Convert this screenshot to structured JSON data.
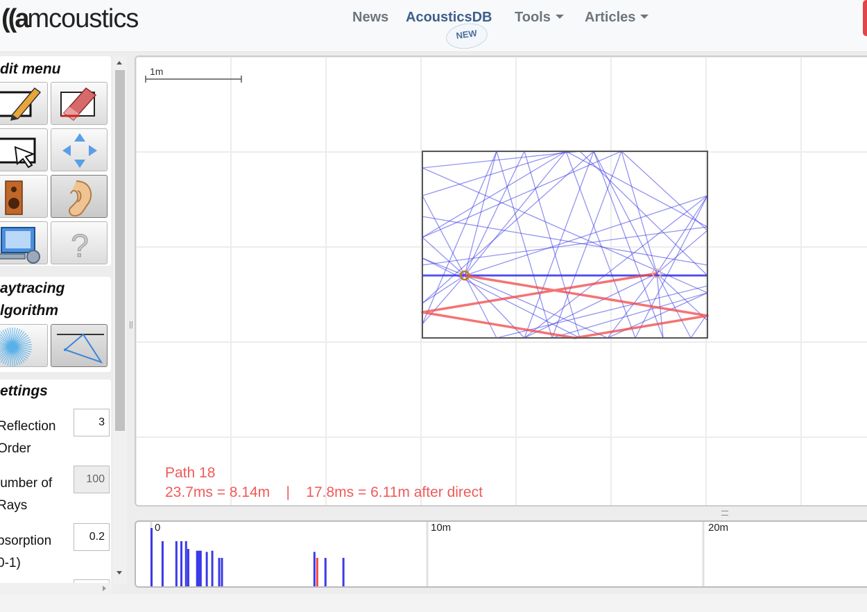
{
  "header": {
    "logo_mark": "((a",
    "logo_text": "mcoustics",
    "nav": [
      {
        "label": "News",
        "dropdown": false
      },
      {
        "label": "AcousticsDB",
        "dropdown": false
      },
      {
        "label": "Tools",
        "dropdown": true
      },
      {
        "label": "Articles",
        "dropdown": true
      }
    ],
    "new_badge": "NEW"
  },
  "sidebar": {
    "edit_menu_title": "dit menu",
    "tools": [
      {
        "icon": "pencil-draw-icon",
        "active": false
      },
      {
        "icon": "eraser-icon",
        "active": false
      },
      {
        "icon": "select-pointer-icon",
        "active": false
      },
      {
        "icon": "move-arrows-icon",
        "active": false
      },
      {
        "icon": "speaker-icon",
        "active": false
      },
      {
        "icon": "ear-icon",
        "active": true
      },
      {
        "icon": "monitor-settings-icon",
        "active": false
      },
      {
        "icon": "help-question-icon",
        "active": false
      }
    ],
    "raytracing_title_line1": "aytracing",
    "raytracing_title_line2": "lgorithm",
    "algorithms": [
      {
        "icon": "stochastic-rays-icon",
        "active": false
      },
      {
        "icon": "image-source-icon",
        "active": true
      }
    ],
    "settings_title": "ettings",
    "settings": [
      {
        "label_line1": "Reflection",
        "label_line2": "Order",
        "value": "3",
        "disabled": false
      },
      {
        "label_line1": "lumber of",
        "label_line2": "Rays",
        "value": "100",
        "disabled": true
      },
      {
        "label_line1": "bsorption",
        "label_line2": "0-1)",
        "value": "0.2",
        "disabled": false
      }
    ]
  },
  "canvas": {
    "scale_label": "1m",
    "path_title": "Path 18",
    "path_details": "23.7ms = 8.14m    |    17.8ms = 6.11m after direct",
    "ray_color": "#3a3ae8",
    "highlight_color": "#f04545"
  },
  "timeline": {
    "tick_labels": [
      "0",
      "10m",
      "20m"
    ],
    "bars": [
      {
        "m": 0.0,
        "h": 1.0,
        "red": false
      },
      {
        "m": 0.4,
        "h": 0.78,
        "red": false
      },
      {
        "m": 0.9,
        "h": 0.78,
        "red": false
      },
      {
        "m": 1.08,
        "h": 0.78,
        "red": false
      },
      {
        "m": 1.25,
        "h": 0.78,
        "red": false
      },
      {
        "m": 1.33,
        "h": 0.65,
        "red": false
      },
      {
        "m": 1.65,
        "h": 0.62,
        "red": false
      },
      {
        "m": 1.72,
        "h": 0.62,
        "red": false
      },
      {
        "m": 1.78,
        "h": 0.62,
        "red": false
      },
      {
        "m": 2.0,
        "h": 0.6,
        "red": false
      },
      {
        "m": 2.2,
        "h": 0.62,
        "red": false
      },
      {
        "m": 2.45,
        "h": 0.5,
        "red": false
      },
      {
        "m": 2.55,
        "h": 0.5,
        "red": false
      },
      {
        "m": 5.9,
        "h": 0.6,
        "red": false
      },
      {
        "m": 6.0,
        "h": 0.5,
        "red": true
      },
      {
        "m": 6.3,
        "h": 0.5,
        "red": false
      },
      {
        "m": 6.95,
        "h": 0.5,
        "red": false
      }
    ]
  }
}
